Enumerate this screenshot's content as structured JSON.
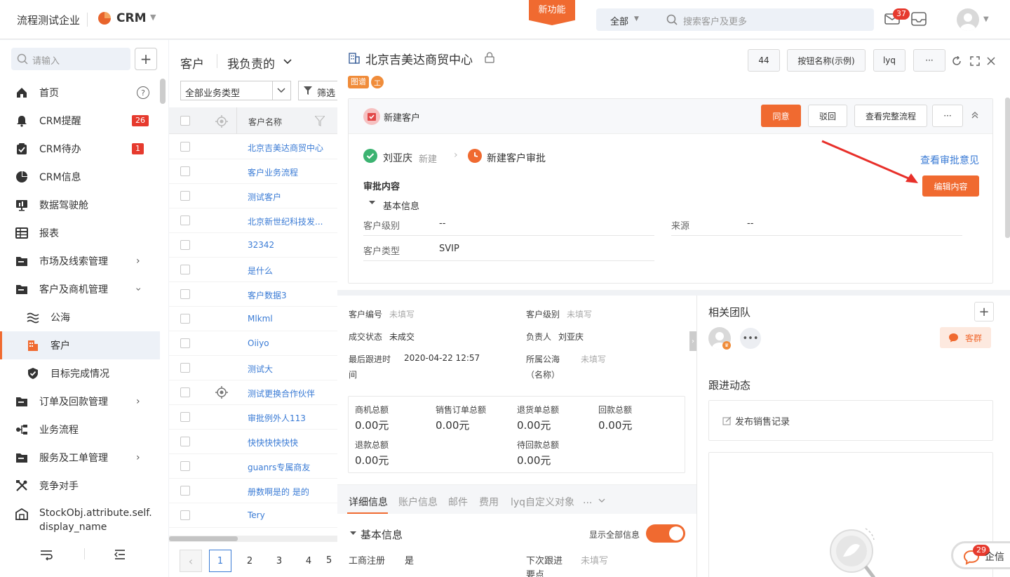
{
  "topbar": {
    "company": "流程测试企业",
    "app": "CRM",
    "new_feature": "新功能",
    "scope": "全部",
    "search_placeholder": "搜索客户及更多",
    "mail_badge": "37"
  },
  "sidebar": {
    "search_placeholder": "请输入",
    "items": [
      {
        "label": "首页",
        "icon": "home-icon"
      },
      {
        "label": "CRM提醒",
        "icon": "bell-icon",
        "badge": "26"
      },
      {
        "label": "CRM待办",
        "icon": "todo-icon",
        "badge": "1"
      },
      {
        "label": "CRM信息",
        "icon": "pie-icon"
      },
      {
        "label": "数据驾驶舱",
        "icon": "dashboard-icon"
      },
      {
        "label": "报表",
        "icon": "table-icon"
      },
      {
        "label": "市场及线索管理",
        "icon": "folder-icon"
      },
      {
        "label": "客户及商机管理",
        "icon": "folder-icon"
      },
      {
        "label": "公海",
        "icon": "waves-icon"
      },
      {
        "label": "客户",
        "icon": "building-icon"
      },
      {
        "label": "目标完成情况",
        "icon": "shield-check-icon"
      },
      {
        "label": "订单及回款管理",
        "icon": "folder-icon"
      },
      {
        "label": "业务流程",
        "icon": "flow-icon"
      },
      {
        "label": "服务及工单管理",
        "icon": "folder-icon"
      },
      {
        "label": "竞争对手",
        "icon": "tools-icon"
      },
      {
        "label": "StockObj.attribute.self.",
        "label2": "display_name",
        "icon": "warehouse-icon"
      }
    ]
  },
  "list": {
    "title": "客户",
    "view": "我负责的",
    "type_filter": "全部业务类型",
    "filter": "筛选",
    "column_name": "客户名称",
    "rows": [
      "北京吉美达商贸中心",
      "客户业务流程",
      "测试客户",
      "北京新世纪科技发...",
      "32342",
      "是什么",
      "客户数据3",
      "Mlkml",
      "Oiiyo",
      "测试大",
      "测试更换合作伙伴",
      "审批例外人113",
      "快快快快快快",
      "guanrs专属商友",
      "册数啊是的 是的",
      "Tery"
    ],
    "pages": [
      "1",
      "2",
      "3",
      "4",
      "5"
    ]
  },
  "detail": {
    "title": "北京吉美达商贸中心",
    "tags": [
      "图谱",
      "工"
    ],
    "btn_count": "44",
    "btn_example": "按钮名称(示例)",
    "btn_user": "lyq",
    "btn_more": "···",
    "approval": {
      "name": "新建客户",
      "agree": "同意",
      "reject": "驳回",
      "full_flow": "查看完整流程",
      "more": "···",
      "step1_user": "刘亚庆",
      "step1_action": "新建",
      "step2": "新建客户审批",
      "view_opinion": "查看审批意见",
      "edit": "编辑内容",
      "content_title": "审批内容",
      "section": "基本信息",
      "fields": [
        {
          "label": "客户级别",
          "value": "--"
        },
        {
          "label": "来源",
          "value": "--"
        },
        {
          "label": "客户类型",
          "value": "SVIP"
        }
      ]
    },
    "info": {
      "customer_no_label": "客户编号",
      "customer_no": "未填写",
      "level_label": "客户级别",
      "level": "未填写",
      "deal_label": "成交状态",
      "deal": "未成交",
      "owner_label": "负责人",
      "owner": "刘亚庆",
      "last_follow_label_1": "最后跟进时",
      "last_follow_label_2": "间",
      "last_follow": "2020-04-22 12:57",
      "pool_label_1": "所属公海",
      "pool_label_2": "（名称）",
      "pool": "未填写"
    },
    "money": [
      {
        "label": "商机总额",
        "value": "0.00元"
      },
      {
        "label": "销售订单总额",
        "value": "0.00元"
      },
      {
        "label": "退货单总额",
        "value": "0.00元"
      },
      {
        "label": "回款总额",
        "value": "0.00元"
      },
      {
        "label": "退款总额",
        "value": "0.00元"
      },
      {
        "label": "待回款总额",
        "value": "0.00元"
      }
    ],
    "tabs": [
      "详细信息",
      "账户信息",
      "邮件",
      "费用",
      "lyq自定义对象",
      "..."
    ],
    "basic": {
      "title": "基本信息",
      "show_all": "显示全部信息",
      "reg_label": "工商注册",
      "reg": "是",
      "next_label_1": "下次跟进",
      "next_label_2": "要点",
      "next": "未填写"
    },
    "team": {
      "title": "相关团队",
      "group": "客群"
    },
    "follow": {
      "title": "跟进动态",
      "publish": "发布销售记录"
    },
    "qixin": {
      "label": "企信",
      "badge": "29"
    }
  }
}
